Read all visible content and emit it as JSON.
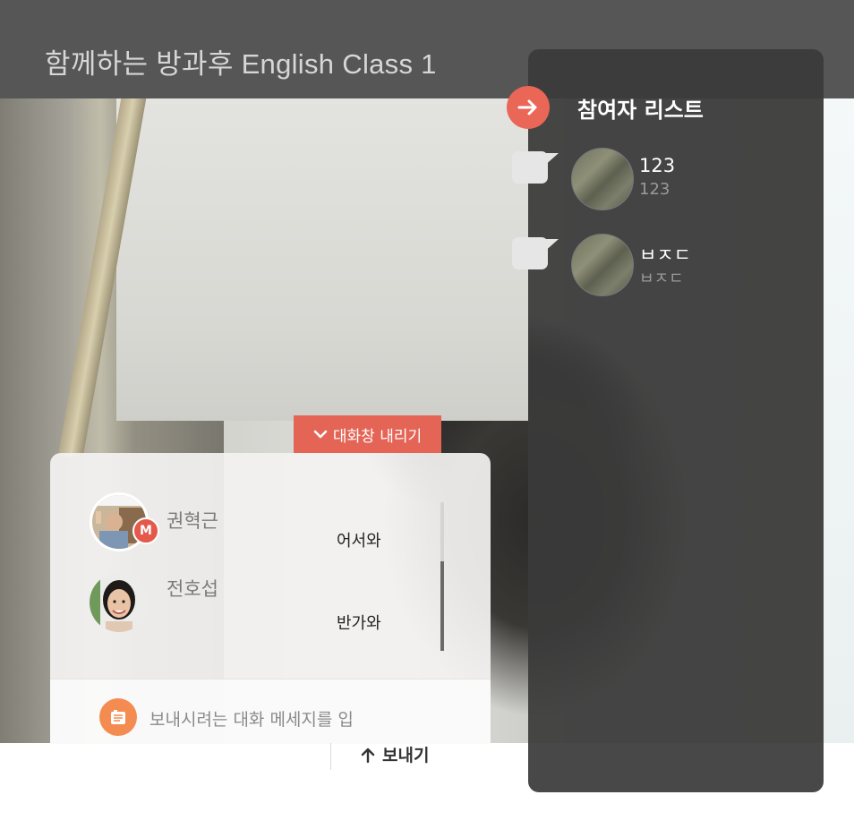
{
  "header": {
    "title": "함께하는 방과후 English Class 1"
  },
  "participants_panel": {
    "title": "참여자 리스트",
    "participants": [
      {
        "name": "123",
        "id": "123"
      },
      {
        "name": "ㅂㅈㄷ",
        "id": "ㅂㅈㄷ"
      }
    ]
  },
  "chat": {
    "toggle_label": "대화창 내리기",
    "messages": [
      {
        "sender": "권혁근",
        "text": "어서와",
        "badge": "M"
      },
      {
        "sender": "전호섭",
        "text": "반가와"
      }
    ],
    "input_placeholder": "보내시려는 대화 메세지를 입",
    "send_label": "보내기"
  },
  "colors": {
    "accent_red": "#e46456",
    "input_icon_orange": "#f48c52",
    "header_bg": "#565656",
    "panel_bg": "#3a3a3a"
  }
}
